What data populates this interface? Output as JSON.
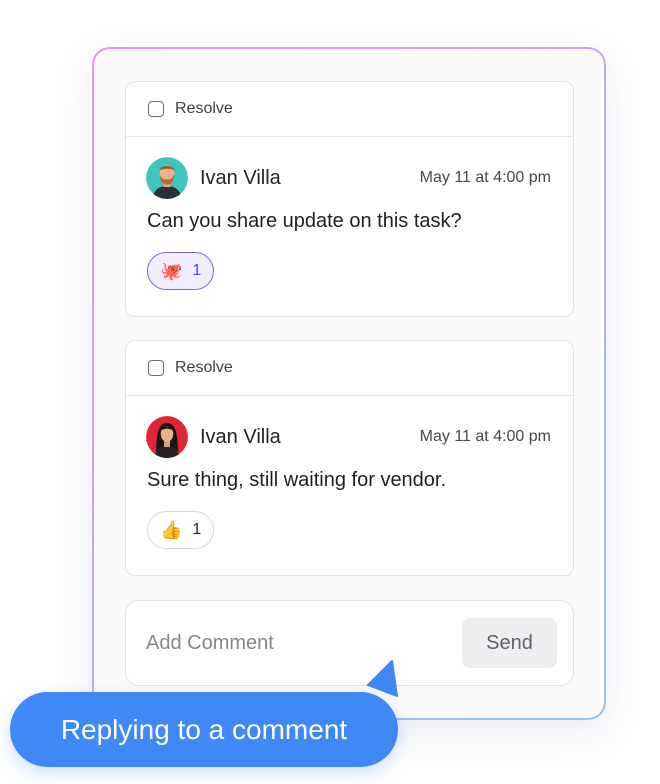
{
  "comments": [
    {
      "resolve_label": "Resolve",
      "author": "Ivan Villa",
      "timestamp": "May 11 at 4:00 pm",
      "message": "Can you share update on this task?",
      "reaction": {
        "icon": "octopus-emoji-icon",
        "emoji": "🐙",
        "count": "1",
        "active": true
      }
    },
    {
      "resolve_label": "Resolve",
      "author": "Ivan Villa",
      "timestamp": "May 11 at 4:00 pm",
      "message": "Sure thing, still waiting for vendor.",
      "reaction": {
        "icon": "thumbs-up-emoji-icon",
        "emoji": "👍",
        "count": "1",
        "active": false
      }
    }
  ],
  "composer": {
    "placeholder": "Add Comment",
    "send_label": "Send"
  },
  "caption": "Replying to a comment",
  "colors": {
    "accent": "#3f88f5",
    "reaction_active": "#7b63d8",
    "frame_gradient_start": "#f08ff0",
    "frame_gradient_end": "#8fc4f8"
  }
}
